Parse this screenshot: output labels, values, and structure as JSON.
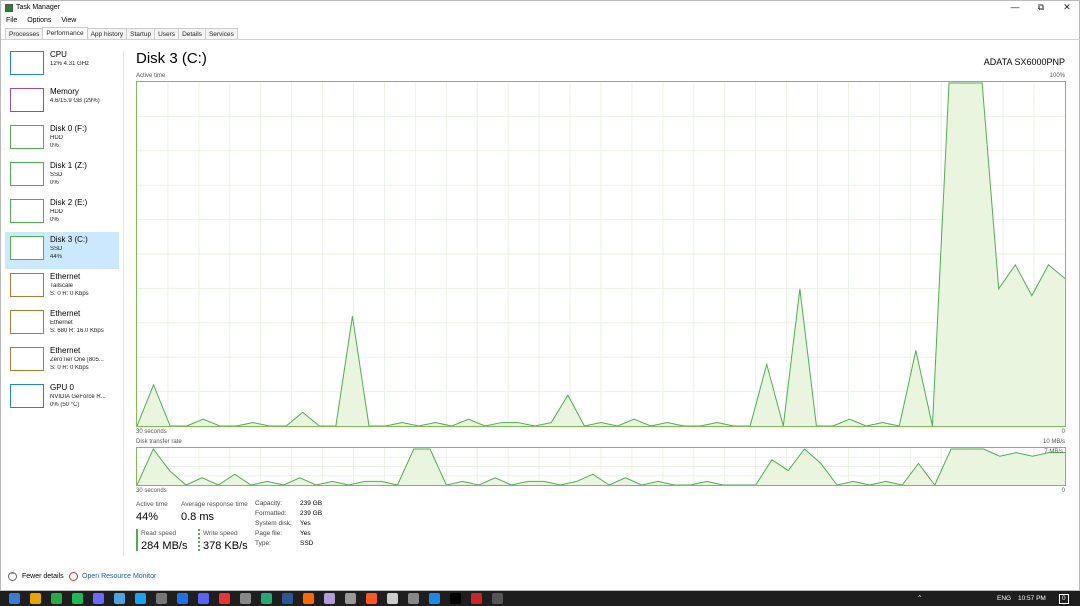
{
  "window": {
    "title": "Task Manager"
  },
  "menu": [
    "File",
    "Options",
    "View"
  ],
  "tabs": [
    "Processes",
    "Performance",
    "App history",
    "Startup",
    "Users",
    "Details",
    "Services"
  ],
  "active_tab": "Performance",
  "sidebar": [
    {
      "name": "CPU",
      "l1": "12% 4.31 GHz",
      "l2": "",
      "l3": "",
      "color": "#1f8ac0"
    },
    {
      "name": "Memory",
      "l1": "4.6/15.9 GB (29%)",
      "l2": "",
      "l3": "",
      "color": "#a34aa8"
    },
    {
      "name": "Disk 0 (F:)",
      "l1": "HDD",
      "l2": "0%",
      "l3": "",
      "color": "#4caf50"
    },
    {
      "name": "Disk 1 (Z:)",
      "l1": "SSD",
      "l2": "0%",
      "l3": "",
      "color": "#4caf50"
    },
    {
      "name": "Disk 2 (E:)",
      "l1": "HDD",
      "l2": "0%",
      "l3": "",
      "color": "#4caf50"
    },
    {
      "name": "Disk 3 (C:)",
      "l1": "SSD",
      "l2": "44%",
      "l3": "",
      "color": "#4caf50"
    },
    {
      "name": "Ethernet",
      "l1": "Tailscale",
      "l2": "S: 0 R: 0 Kbps",
      "l3": "",
      "color": "#b07a30"
    },
    {
      "name": "Ethernet",
      "l1": "Ethernet",
      "l2": "S: 680 R: 16.0 Kbps",
      "l3": "",
      "color": "#b07a30"
    },
    {
      "name": "Ethernet",
      "l1": "ZeroTier One [805...",
      "l2": "S: 0 R: 0 Kbps",
      "l3": "",
      "color": "#b07a30"
    },
    {
      "name": "GPU 0",
      "l1": "NVIDIA GeForce R...",
      "l2": "0% (50 °C)",
      "l3": "",
      "color": "#1f8ac0"
    }
  ],
  "selected_index": 5,
  "main": {
    "title": "Disk 3 (C:)",
    "model": "ADATA SX6000PNP",
    "active_chart_label": "Active time",
    "active_chart_max": "100%",
    "active_chart_time": "30 seconds",
    "active_chart_min": "0",
    "transfer_chart_label": "Disk transfer rate",
    "transfer_chart_max": "10 MB/s",
    "transfer_chart_mid": "7 MB/s",
    "transfer_chart_time": "30 seconds",
    "transfer_chart_min": "0"
  },
  "stats": {
    "active_time_label": "Active time",
    "active_time": "44%",
    "response_label": "Average response time",
    "response": "0.8 ms",
    "read_label": "Read speed",
    "read": "284 MB/s",
    "write_label": "Write speed",
    "write": "378 KB/s"
  },
  "properties": [
    {
      "k": "Capacity:",
      "v": "239 GB"
    },
    {
      "k": "Formatted:",
      "v": "239 GB"
    },
    {
      "k": "System disk:",
      "v": "Yes"
    },
    {
      "k": "Page file:",
      "v": "Yes"
    },
    {
      "k": "Type:",
      "v": "SSD"
    }
  ],
  "footer": {
    "fewer": "Fewer details",
    "monitor": "Open Resource Monitor"
  },
  "tray": {
    "lang": "ENG",
    "time": "10:57 PM",
    "notif": "0"
  },
  "chart_data": {
    "type": "area",
    "active_time": {
      "ylim": [
        0,
        100
      ],
      "values": [
        0,
        12,
        0,
        0,
        2,
        0,
        0,
        1,
        0,
        0,
        4,
        0,
        0,
        32,
        0,
        0,
        1,
        0,
        1,
        0,
        2,
        0,
        1,
        1,
        0,
        1,
        9,
        0,
        1,
        0,
        2,
        0,
        1,
        0,
        0,
        1,
        0,
        0,
        18,
        0,
        40,
        0,
        0,
        2,
        0,
        1,
        0,
        22,
        0,
        100,
        100,
        100,
        40,
        47,
        38,
        47,
        43
      ]
    },
    "transfer_rate": {
      "ylim": [
        0,
        10
      ],
      "values": [
        0,
        10,
        4,
        0,
        2,
        0,
        3,
        0,
        1,
        0,
        2,
        0,
        1,
        0,
        1,
        1,
        0,
        10,
        10,
        0,
        1,
        0,
        2,
        0,
        1,
        1,
        0,
        1,
        3,
        0,
        2,
        0,
        1,
        0,
        0,
        1,
        0,
        0,
        0,
        7,
        4,
        10,
        6,
        0,
        1,
        0,
        1,
        0,
        6,
        0,
        10,
        10,
        10,
        8,
        9,
        8,
        9,
        9
      ]
    }
  }
}
